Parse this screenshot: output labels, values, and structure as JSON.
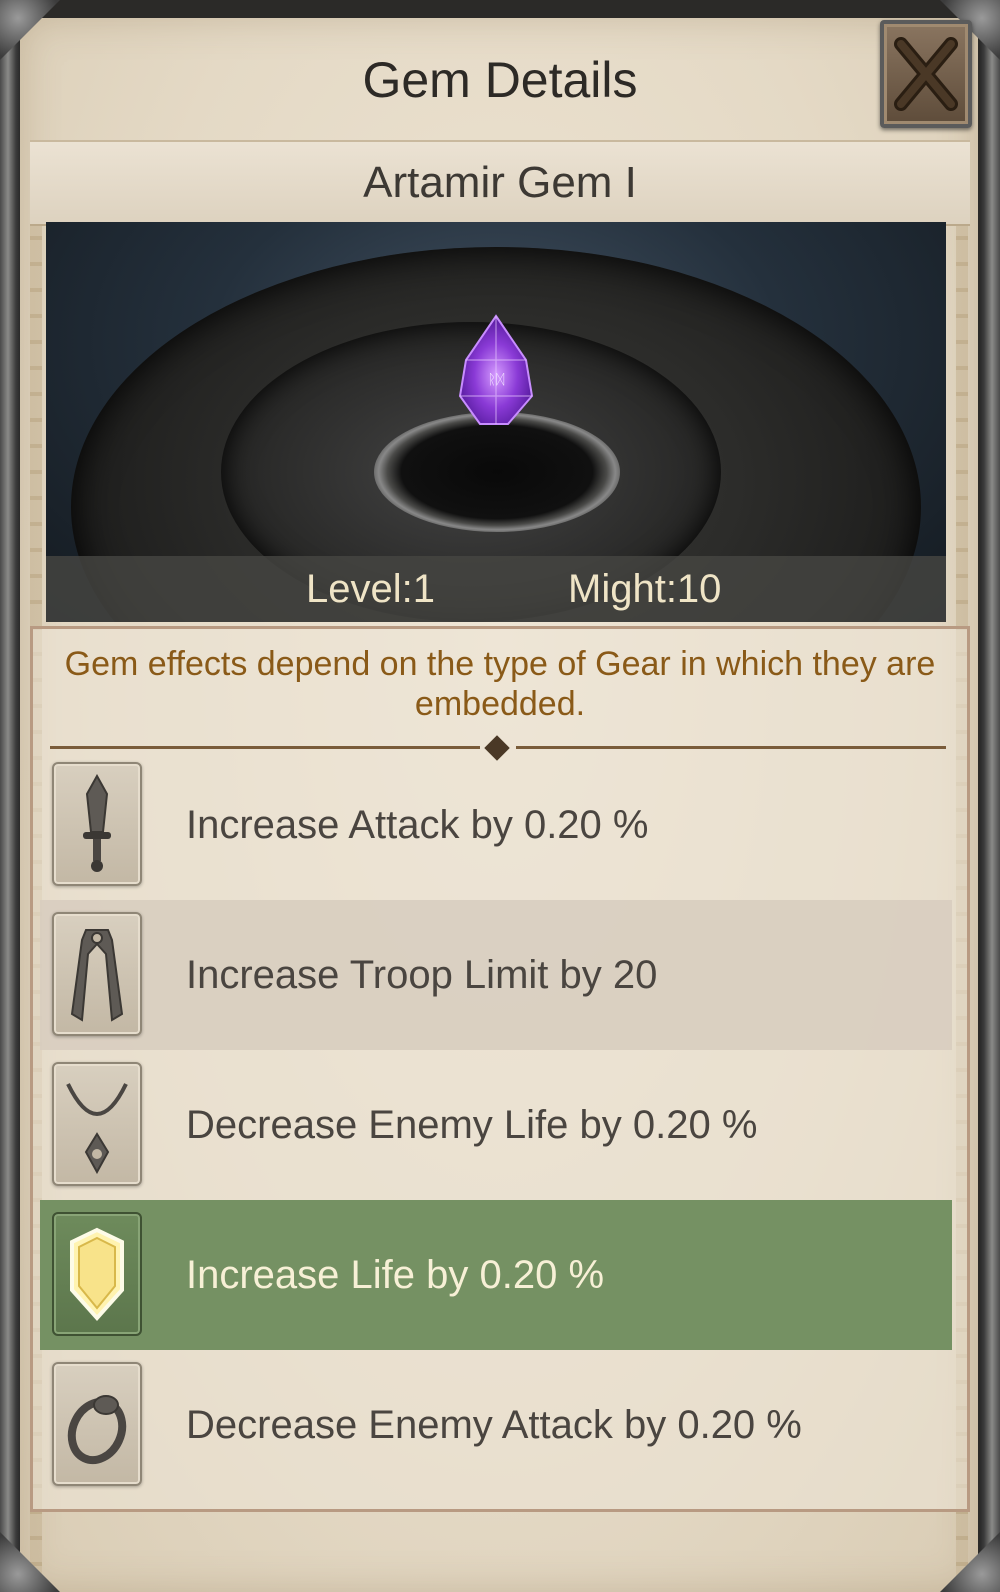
{
  "window": {
    "title": "Gem Details",
    "close_icon": "close-x-icon"
  },
  "gem": {
    "name": "Artamir Gem I",
    "level_text": "Level:1",
    "might_text": "Might:10",
    "icon": "purple-gem-icon"
  },
  "info_text": "Gem effects depend on the type of Gear in which they are embedded.",
  "effects": [
    {
      "icon": "sword-icon",
      "label": "Increase Attack by 0.20 %",
      "selected": false
    },
    {
      "icon": "cloak-icon",
      "label": "Increase Troop Limit by 20",
      "selected": false
    },
    {
      "icon": "necklace-icon",
      "label": "Decrease Enemy Life by 0.20 %",
      "selected": false
    },
    {
      "icon": "shield-icon",
      "label": "Increase Life by 0.20 %",
      "selected": true
    },
    {
      "icon": "ring-icon",
      "label": "Decrease Enemy Attack by 0.20 %",
      "selected": false
    }
  ],
  "colors": {
    "highlight": "#759163",
    "info_text": "#8a5a18",
    "gem": "#8a3ad6"
  }
}
